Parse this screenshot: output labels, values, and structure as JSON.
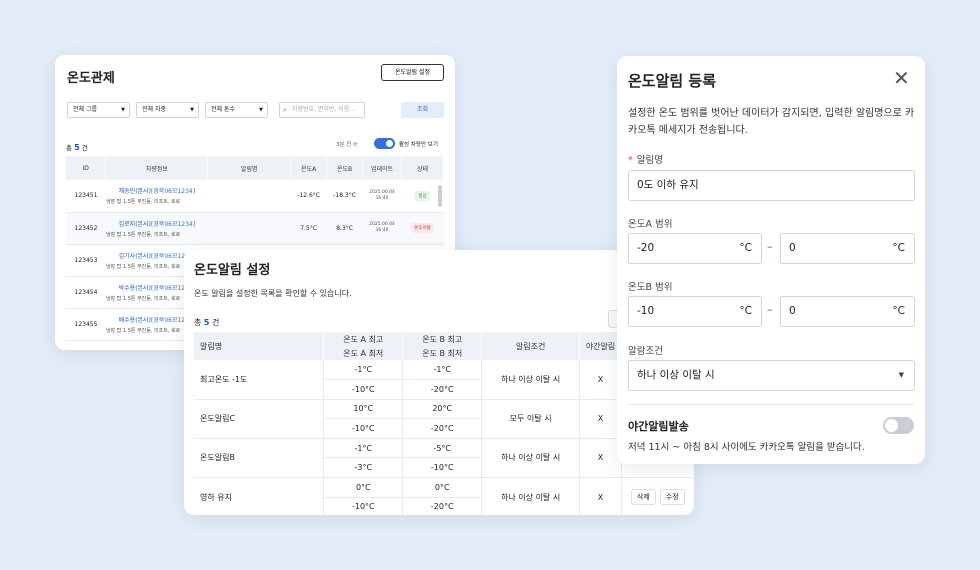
{
  "monitor": {
    "title": "온도관제",
    "alarm_setting_button": "온도알림 설정",
    "filters": [
      "전체 그룹",
      "전체 차종",
      "전체 톤수"
    ],
    "search_placeholder": "차량번호, 면허번, 이름...",
    "query_button": "조회",
    "count_prefix": "총",
    "count": "5",
    "count_suffix": "건",
    "refresh_text": "3분 전",
    "toggle_label": "활성 차량만 보기",
    "columns": [
      "ID",
      "차량정보",
      "알림명",
      "온도A",
      "온도B",
      "업데이트",
      "상태"
    ],
    "rows": [
      {
        "id": "123451",
        "name": "채승민(본사)",
        "plate": "[경북06모1234]",
        "sub": "냉장 탑 1.5톤 무진동, 리프트, 호로",
        "tempA": "-12.6°C",
        "tempB": "-18.3°C",
        "date": "2025.06.04",
        "time": "16:40",
        "status": "정상"
      },
      {
        "id": "123452",
        "name": "김로지(본사)",
        "plate": "[경북06모1234]",
        "sub": "냉장 탑 1.5톤 무진동, 리프트, 호로",
        "tempA": "7.5°C",
        "tempB": "8.3°C",
        "date": "2025.06.04",
        "time": "16:40",
        "status": "온도이탈"
      },
      {
        "id": "123453",
        "name": "김기사(본사)",
        "plate": "[경북06모1234]",
        "sub": "냉장 탑 1.5톤 무진동, 리프트, 호로"
      },
      {
        "id": "123454",
        "name": "박수용(본사)",
        "plate": "[경북06모1234]",
        "sub": "냉장 탑 1.5톤 무진동, 리프트, 호로"
      },
      {
        "id": "123455",
        "name": "배수용(본사)",
        "plate": "[경북06모1234]",
        "sub": "냉장 탑 1.5톤 무진동, 리프트, 호로"
      }
    ]
  },
  "settings": {
    "title": "온도알림 설정",
    "description": "온도 알림을 설정한 목록을 확인할 수 있습니다.",
    "count_prefix": "총",
    "count": "5",
    "count_suffix": "건",
    "columns": {
      "name": "알림명",
      "a_max": "온도 A 최고",
      "a_min": "온도 A 최저",
      "b_max": "온도 B 최고",
      "b_min": "온도 B 최저",
      "condition": "알림조건",
      "night": "야간알림"
    },
    "rows": [
      {
        "name": "최고온도 -1도",
        "a_max": "-1°C",
        "a_min": "-10°C",
        "b_max": "-1°C",
        "b_min": "-20°C",
        "condition": "하나 이상 이탈 시",
        "night": "X"
      },
      {
        "name": "온도알림C",
        "a_max": "10°C",
        "a_min": "-10°C",
        "b_max": "20°C",
        "b_min": "-20°C",
        "condition": "모두 이탈 시",
        "night": "X"
      },
      {
        "name": "온도알림B",
        "a_max": "-1°C",
        "a_min": "-3°C",
        "b_max": "-5°C",
        "b_min": "-10°C",
        "condition": "하나 이상 이탈 시",
        "night": "X"
      },
      {
        "name": "영하 유지",
        "a_max": "0°C",
        "a_min": "-10°C",
        "b_max": "0°C",
        "b_min": "-20°C",
        "condition": "하나 이상 이탈 시",
        "night": "X"
      }
    ],
    "delete_label": "삭제",
    "edit_label": "수정"
  },
  "register": {
    "title": "온도알림 등록",
    "description": "설정한 온도 범위를 벗어난 데이터가 감지되면, 입력한 알림명으로 카카오톡 메세지가 전송됩니다.",
    "name_label": "알림명",
    "required_mark": "*",
    "name_value": "0도 이하 유지",
    "rangeA_label": "온도A 범위",
    "rangeA_min": "-20",
    "rangeA_max": "0",
    "rangeB_label": "온도B 범위",
    "rangeB_min": "-10",
    "rangeB_max": "0",
    "unit": "°C",
    "range_sep": "–",
    "condition_label": "알람조건",
    "condition_value": "하나 이상 이탈 시",
    "night_title": "야간알림발송",
    "night_desc": "저녁 11시 ~ 아침 8시 사이에도 카카오톡 알림을 받습니다.",
    "night_enabled": false
  }
}
